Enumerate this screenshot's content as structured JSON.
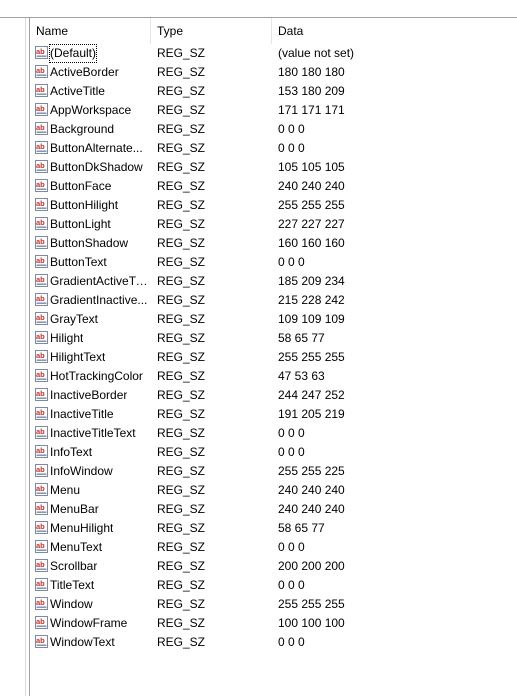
{
  "columns": {
    "name": "Name",
    "type": "Type",
    "data": "Data"
  },
  "colors": {
    "icon_red": "#c8302a",
    "icon_frame": "#7a8aa8",
    "grid_line": "#e5e5e5"
  },
  "icon_name": "string-value-icon",
  "rows": [
    {
      "name": "(Default)",
      "type": "REG_SZ",
      "data": "(value not set)",
      "selected": true
    },
    {
      "name": "ActiveBorder",
      "type": "REG_SZ",
      "data": "180 180 180"
    },
    {
      "name": "ActiveTitle",
      "type": "REG_SZ",
      "data": "153 180 209"
    },
    {
      "name": "AppWorkspace",
      "type": "REG_SZ",
      "data": "171 171 171"
    },
    {
      "name": "Background",
      "type": "REG_SZ",
      "data": "0 0 0"
    },
    {
      "name": "ButtonAlternate...",
      "type": "REG_SZ",
      "data": "0 0 0"
    },
    {
      "name": "ButtonDkShadow",
      "type": "REG_SZ",
      "data": "105 105 105"
    },
    {
      "name": "ButtonFace",
      "type": "REG_SZ",
      "data": "240 240 240"
    },
    {
      "name": "ButtonHilight",
      "type": "REG_SZ",
      "data": "255 255 255"
    },
    {
      "name": "ButtonLight",
      "type": "REG_SZ",
      "data": "227 227 227"
    },
    {
      "name": "ButtonShadow",
      "type": "REG_SZ",
      "data": "160 160 160"
    },
    {
      "name": "ButtonText",
      "type": "REG_SZ",
      "data": "0 0 0"
    },
    {
      "name": "GradientActiveTi...",
      "type": "REG_SZ",
      "data": "185 209 234"
    },
    {
      "name": "GradientInactive...",
      "type": "REG_SZ",
      "data": "215 228 242"
    },
    {
      "name": "GrayText",
      "type": "REG_SZ",
      "data": "109 109 109"
    },
    {
      "name": "Hilight",
      "type": "REG_SZ",
      "data": "58 65 77"
    },
    {
      "name": "HilightText",
      "type": "REG_SZ",
      "data": "255 255 255"
    },
    {
      "name": "HotTrackingColor",
      "type": "REG_SZ",
      "data": "47 53 63"
    },
    {
      "name": "InactiveBorder",
      "type": "REG_SZ",
      "data": "244 247 252"
    },
    {
      "name": "InactiveTitle",
      "type": "REG_SZ",
      "data": "191 205 219"
    },
    {
      "name": "InactiveTitleText",
      "type": "REG_SZ",
      "data": "0 0 0"
    },
    {
      "name": "InfoText",
      "type": "REG_SZ",
      "data": "0 0 0"
    },
    {
      "name": "InfoWindow",
      "type": "REG_SZ",
      "data": "255 255 225"
    },
    {
      "name": "Menu",
      "type": "REG_SZ",
      "data": "240 240 240"
    },
    {
      "name": "MenuBar",
      "type": "REG_SZ",
      "data": "240 240 240"
    },
    {
      "name": "MenuHilight",
      "type": "REG_SZ",
      "data": "58 65 77"
    },
    {
      "name": "MenuText",
      "type": "REG_SZ",
      "data": "0 0 0"
    },
    {
      "name": "Scrollbar",
      "type": "REG_SZ",
      "data": "200 200 200"
    },
    {
      "name": "TitleText",
      "type": "REG_SZ",
      "data": "0 0 0"
    },
    {
      "name": "Window",
      "type": "REG_SZ",
      "data": "255 255 255"
    },
    {
      "name": "WindowFrame",
      "type": "REG_SZ",
      "data": "100 100 100"
    },
    {
      "name": "WindowText",
      "type": "REG_SZ",
      "data": "0 0 0"
    }
  ]
}
